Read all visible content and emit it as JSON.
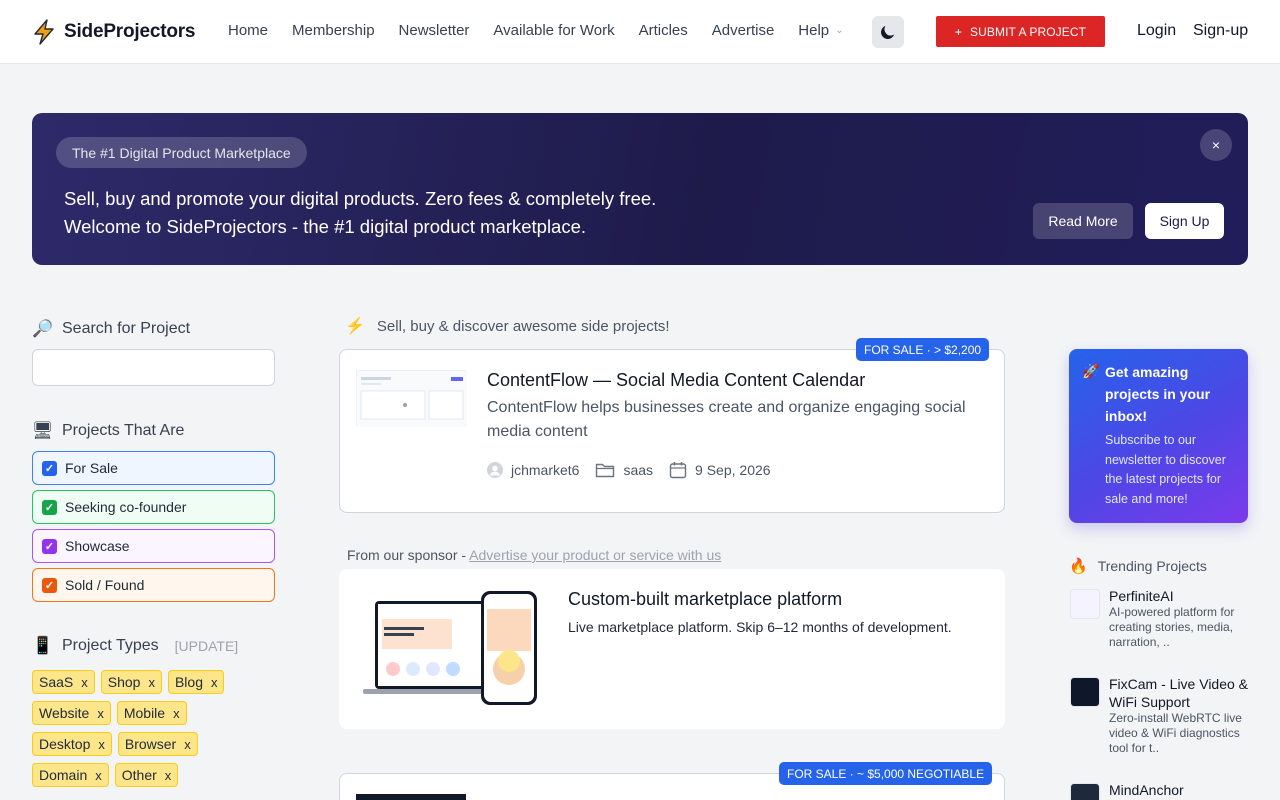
{
  "brand": {
    "name": "SideProjectors"
  },
  "nav": {
    "items": [
      "Home",
      "Membership",
      "Newsletter",
      "Available for Work",
      "Articles",
      "Advertise",
      "Help"
    ],
    "submit_label": "SUBMIT A PROJECT",
    "login": "Login",
    "signup": "Sign-up"
  },
  "hero": {
    "pill": "The #1 Digital Product Marketplace",
    "line1": "Sell, buy and promote your digital products. Zero fees & completely free.",
    "line2": "Welcome to SideProjectors - the #1 digital product marketplace.",
    "close": "×",
    "read_more": "Read More",
    "sign_up": "Sign Up"
  },
  "sidebar": {
    "search_heading": "Search for Project",
    "search_placeholder": "",
    "status_heading": "Projects That Are",
    "filters": [
      {
        "label": "For Sale",
        "checked": true,
        "color": "#2563eb"
      },
      {
        "label": "Seeking co-founder",
        "checked": true,
        "color": "#16a34a"
      },
      {
        "label": "Showcase",
        "checked": true,
        "color": "#9333ea"
      },
      {
        "label": "Sold / Found",
        "checked": true,
        "color": "#ea580c"
      }
    ],
    "types_heading": "Project Types",
    "types_update": "[UPDATE]",
    "tags": [
      "SaaS",
      "Shop",
      "Blog",
      "Website",
      "Mobile",
      "Desktop",
      "Browser",
      "Domain",
      "Other"
    ],
    "tag_remove": "x"
  },
  "main": {
    "heading": "Sell, buy & discover awesome side projects!",
    "project1": {
      "badge": "FOR SALE · > $2,200",
      "title": "ContentFlow — Social Media Content Calendar",
      "description": "ContentFlow helps businesses create and organize engaging social media content",
      "author": "jchmarket6",
      "category": "saas",
      "date": "9 Sep, 2026"
    },
    "sponsor": {
      "prefix": "From our sponsor - ",
      "link": "Advertise your product or service with us",
      "title": "Custom-built marketplace platform",
      "description": "Live marketplace platform. Skip 6–12 months of development."
    },
    "project2": {
      "badge": "FOR SALE · ~ $5,000 NEGOTIABLE"
    }
  },
  "right": {
    "newsletter": {
      "title": "Get amazing projects in your inbox!",
      "body": "Subscribe to our newsletter to discover the latest projects for sale and more!"
    },
    "trending_heading": "Trending Projects",
    "trending": [
      {
        "name": "PerfiniteAI",
        "desc": "AI-powered platform for creating stories, media, narration, .."
      },
      {
        "name": "FixCam - Live Video & WiFi Support",
        "desc": "Zero-install WebRTC live video & WiFi diagnostics tool for t.."
      },
      {
        "name": "MindAnchor",
        "desc": ""
      }
    ]
  },
  "colors": {
    "accent": "#dc2626",
    "hero": "#1e1b4b",
    "badge": "#2563eb",
    "tag": "#fde68a"
  }
}
